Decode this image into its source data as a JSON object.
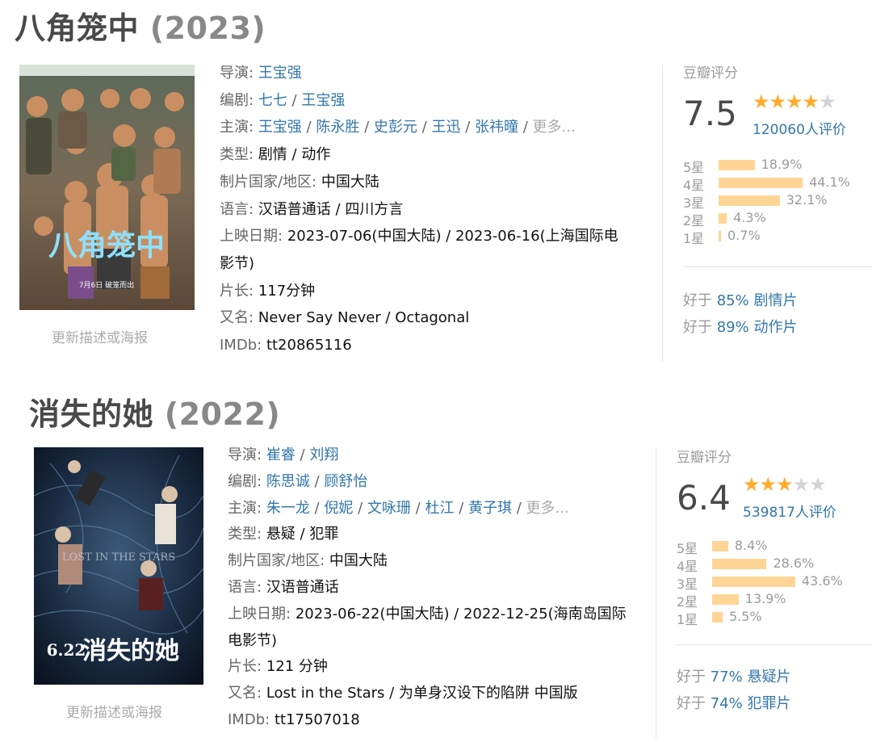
{
  "movies": [
    {
      "title": "八角笼中",
      "year": "(2023)",
      "update_poster_label": "更新描述或海报",
      "director_label": "导演:",
      "directors": [
        "王宝强"
      ],
      "writer_label": "编剧:",
      "writers": [
        "七七",
        "王宝强"
      ],
      "cast_label": "主演:",
      "cast": [
        "王宝强",
        "陈永胜",
        "史彭元",
        "王迅",
        "张祎曈"
      ],
      "more_label": "更多...",
      "genre_label": "类型:",
      "genres": "剧情 / 动作",
      "country_label": "制片国家/地区:",
      "country": "中国大陆",
      "language_label": "语言:",
      "language": "汉语普通话 / 四川方言",
      "release_label": "上映日期:",
      "release_line1": "2023-07-06(中国大陆) / 2023-06-16(上海国际电",
      "release_line2": "影节)",
      "runtime_label": "片长:",
      "runtime": "117分钟",
      "aka_label": "又名:",
      "aka": "Never Say Never / Octagonal",
      "imdb_label": "IMDb:",
      "imdb": "tt20865116",
      "rating_label": "豆瓣评分",
      "score": "7.5",
      "stars_filled": 4,
      "stars_total": 5,
      "rating_count": "120060人评价",
      "distribution": [
        {
          "label": "5星",
          "percent": "18.9%",
          "value": 18.9
        },
        {
          "label": "4星",
          "percent": "44.1%",
          "value": 44.1
        },
        {
          "label": "3星",
          "percent": "32.1%",
          "value": 32.1
        },
        {
          "label": "2星",
          "percent": "4.3%",
          "value": 4.3
        },
        {
          "label": "1星",
          "percent": "0.7%",
          "value": 0.7
        }
      ],
      "better_than": [
        {
          "prefix": "好于",
          "percent": "85%",
          "genre": "剧情片"
        },
        {
          "prefix": "好于",
          "percent": "89%",
          "genre": "动作片"
        }
      ],
      "poster_text": "八角笼中",
      "poster_date": "7月6日 破笼而出"
    },
    {
      "title": "消失的她",
      "year": "(2022)",
      "update_poster_label": "更新描述或海报",
      "director_label": "导演:",
      "directors": [
        "崔睿",
        "刘翔"
      ],
      "writer_label": "编剧:",
      "writers": [
        "陈思诚",
        "顾舒怡"
      ],
      "cast_label": "主演:",
      "cast": [
        "朱一龙",
        "倪妮",
        "文咏珊",
        "杜江",
        "黄子琪"
      ],
      "more_label": "更多...",
      "genre_label": "类型:",
      "genres": "悬疑 / 犯罪",
      "country_label": "制片国家/地区:",
      "country": "中国大陆",
      "language_label": "语言:",
      "language": "汉语普通话",
      "release_label": "上映日期:",
      "release_line1": "2023-06-22(中国大陆) / 2022-12-25(海南岛国际",
      "release_line2": "电影节)",
      "runtime_label": "片长:",
      "runtime": "121 分钟",
      "aka_label": "又名:",
      "aka": "Lost in the Stars / 为单身汉设下的陷阱 中国版",
      "imdb_label": "IMDb:",
      "imdb": "tt17507018",
      "rating_label": "豆瓣评分",
      "score": "6.4",
      "stars_filled": 3,
      "stars_total": 5,
      "rating_count": "539817人评价",
      "distribution": [
        {
          "label": "5星",
          "percent": "8.4%",
          "value": 8.4
        },
        {
          "label": "4星",
          "percent": "28.6%",
          "value": 28.6
        },
        {
          "label": "3星",
          "percent": "43.6%",
          "value": 43.6
        },
        {
          "label": "2星",
          "percent": "13.9%",
          "value": 13.9
        },
        {
          "label": "1星",
          "percent": "5.5%",
          "value": 5.5
        }
      ],
      "better_than": [
        {
          "prefix": "好于",
          "percent": "77%",
          "genre": "悬疑片"
        },
        {
          "prefix": "好于",
          "percent": "74%",
          "genre": "犯罪片"
        }
      ],
      "poster_text": "消失的她",
      "poster_date": "6.22",
      "poster_subtitle": "LOST IN THE STARS"
    }
  ],
  "colors": {
    "link": "#3377aa",
    "star_on": "#ffac2d",
    "star_off": "#d4d4d4",
    "bar": "#ffd596",
    "muted": "#9b9b9b"
  }
}
